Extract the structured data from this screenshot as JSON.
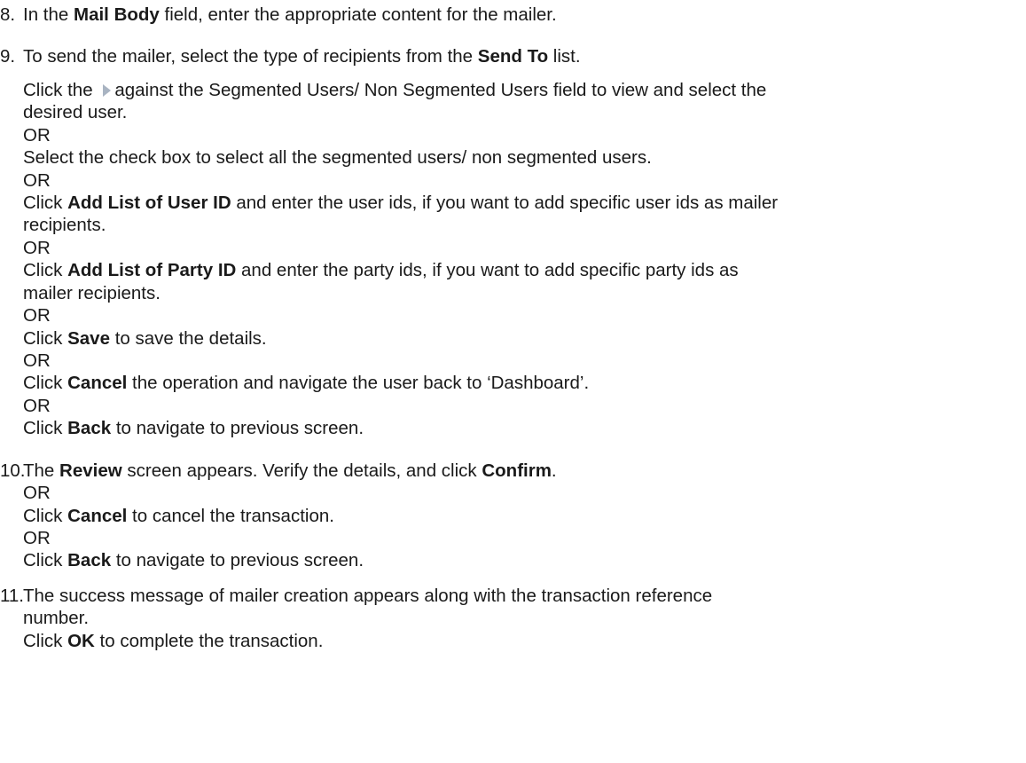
{
  "steps": [
    {
      "number": "8.",
      "lines": [
        {
          "t1": "In the ",
          "b1": "Mail Body",
          "t2": " field, enter the appropriate content for the mailer."
        }
      ]
    },
    {
      "number": "9.",
      "lines": [
        {
          "t1": "To send the mailer, select the type of recipients from the ",
          "b1": "Send To",
          "t2": " list."
        },
        {
          "t1": "Click the ",
          "t2": "against the Segmented Users/ Non Segmented Users field to view and select the"
        },
        {
          "t1": "desired user."
        },
        {
          "t1": "OR"
        },
        {
          "t1": "Select the check box to select all the segmented users/ non segmented users."
        },
        {
          "t1": "OR"
        },
        {
          "t1": "Click ",
          "b1": "Add List of User ID",
          "t2": " and enter the user ids, if you want to add specific user ids as mailer"
        },
        {
          "t1": "recipients."
        },
        {
          "t1": "OR"
        },
        {
          "t1": "Click ",
          "b1": "Add List of Party ID",
          "t2": " and enter the party ids, if you want to add specific party ids as"
        },
        {
          "t1": "mailer recipients."
        },
        {
          "t1": "OR"
        },
        {
          "t1": "Click ",
          "b1": "Save",
          "t2": " to save the details."
        },
        {
          "t1": "OR"
        },
        {
          "t1": "Click ",
          "b1": "Cancel",
          "t2": " the operation and navigate the user back to ‘Dashboard’."
        },
        {
          "t1": "OR"
        },
        {
          "t1": "Click ",
          "b1": "Back",
          "t2": " to navigate to previous screen."
        }
      ]
    },
    {
      "number": "10.",
      "lines": [
        {
          "t1": "The ",
          "b1": "Review",
          "t2": " screen appears. Verify the details, and click ",
          "b2": "Confirm",
          "t3": "."
        },
        {
          "t1": "OR"
        },
        {
          "t1": "Click ",
          "b1": "Cancel",
          "t2": " to cancel the transaction."
        },
        {
          "t1": "OR"
        },
        {
          "t1": "Click ",
          "b1": "Back",
          "t2": " to navigate to previous screen."
        }
      ]
    },
    {
      "number": "11.",
      "lines": [
        {
          "t1": "The success message of mailer creation appears along with the transaction reference"
        },
        {
          "t1": "number."
        },
        {
          "t1": "Click ",
          "b1": "OK",
          "t2": " to complete the transaction."
        }
      ]
    }
  ]
}
